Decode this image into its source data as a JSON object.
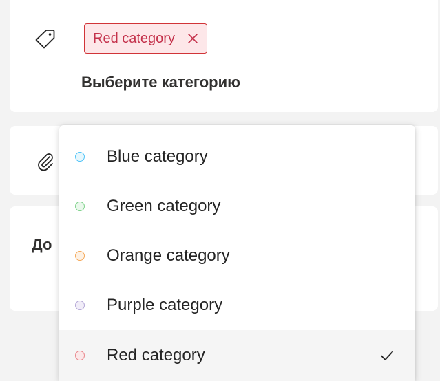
{
  "category": {
    "chip_label": "Red category",
    "chip_color": "#d13438",
    "select_prompt": "Выберите категорию"
  },
  "more": {
    "label_visible": "До"
  },
  "dropdown": {
    "options": [
      {
        "label": "Blue category",
        "color": "#4fc3f7",
        "fill": "#e6f7fd",
        "selected": false
      },
      {
        "label": "Green category",
        "color": "#7fd28b",
        "fill": "#eaf8ec",
        "selected": false
      },
      {
        "label": "Orange category",
        "color": "#f5a95a",
        "fill": "#fdf1e4",
        "selected": false
      },
      {
        "label": "Purple category",
        "color": "#b4a7d6",
        "fill": "#f1edf8",
        "selected": false
      },
      {
        "label": "Red category",
        "color": "#e9868b",
        "fill": "#fbe8e9",
        "selected": true
      }
    ]
  },
  "icons": {
    "tag": "tag-icon",
    "attachment": "paperclip-icon",
    "remove": "close-icon",
    "check": "checkmark-icon"
  }
}
